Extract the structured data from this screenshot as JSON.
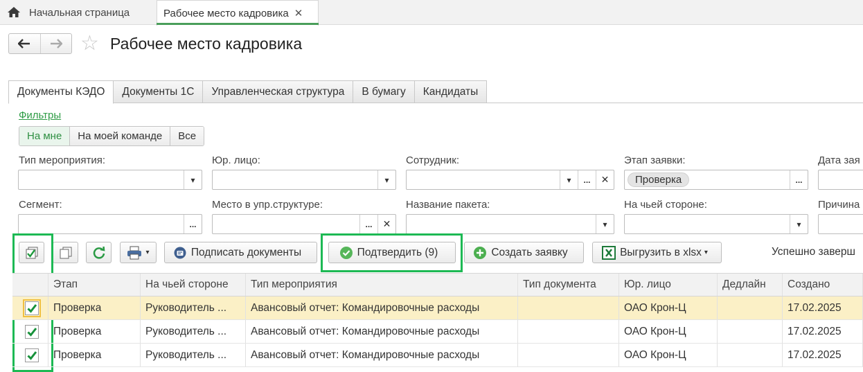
{
  "window_tabs": {
    "home_label": "Начальная страница",
    "doc_label": "Рабочее место кадровика",
    "close_glyph": "✕"
  },
  "header": {
    "title": "Рабочее место кадровика",
    "back_glyph": "🡐",
    "forward_glyph": "🡒",
    "star_glyph": "☆"
  },
  "section_tabs": [
    "Документы КЭДО",
    "Документы 1С",
    "Управленческая структура",
    "В бумагу",
    "Кандидаты"
  ],
  "filters": {
    "link": "Фильтры",
    "scope": [
      "На мне",
      "На моей команде",
      "Все"
    ],
    "fields": {
      "event_type": {
        "label": "Тип мероприятия:",
        "value": ""
      },
      "legal_entity": {
        "label": "Юр. лицо:",
        "value": ""
      },
      "employee": {
        "label": "Сотрудник:",
        "value": ""
      },
      "stage": {
        "label": "Этап заявки:",
        "value": "Проверка"
      },
      "date": {
        "label": "Дата зая",
        "value": ""
      },
      "segment": {
        "label": "Сегмент:",
        "value": ""
      },
      "org_place": {
        "label": "Место в упр.структуре:",
        "value": ""
      },
      "package_name": {
        "label": "Название пакета:",
        "value": ""
      },
      "whose_side": {
        "label": "На чьей стороне:",
        "value": ""
      },
      "reason": {
        "label": "Причина",
        "value": ""
      }
    }
  },
  "toolbar": {
    "sign_label": "Подписать документы",
    "confirm_label": "Подтвердить (9)",
    "create_label": "Создать заявку",
    "export_label": "Выгрузить в xlsx",
    "status_text": "Успешно заверш"
  },
  "table": {
    "columns": [
      "Этап",
      "На чьей стороне",
      "Тип мероприятия",
      "Тип документа",
      "Юр. лицо",
      "Дедлайн",
      "Создано"
    ],
    "rows": [
      {
        "checked": true,
        "stage": "Проверка",
        "side": "Руководитель ...",
        "event": "Авансовый отчет: Командировочные расходы",
        "doc_type": "",
        "entity": "ОАО Крон-Ц",
        "deadline": "",
        "created": "17.02.2025"
      },
      {
        "checked": true,
        "stage": "Проверка",
        "side": "Руководитель ...",
        "event": "Авансовый отчет: Командировочные расходы",
        "doc_type": "",
        "entity": "ОАО Крон-Ц",
        "deadline": "",
        "created": "17.02.2025"
      },
      {
        "checked": true,
        "stage": "Проверка",
        "side": "Руководитель ...",
        "event": "Авансовый отчет: Командировочные расходы",
        "doc_type": "",
        "entity": "ОАО Крон-Ц",
        "deadline": "",
        "created": "17.02.2025"
      }
    ]
  },
  "colors": {
    "accent": "#1db954",
    "selected_row": "#fbf0c6",
    "link": "#2e9c45"
  }
}
